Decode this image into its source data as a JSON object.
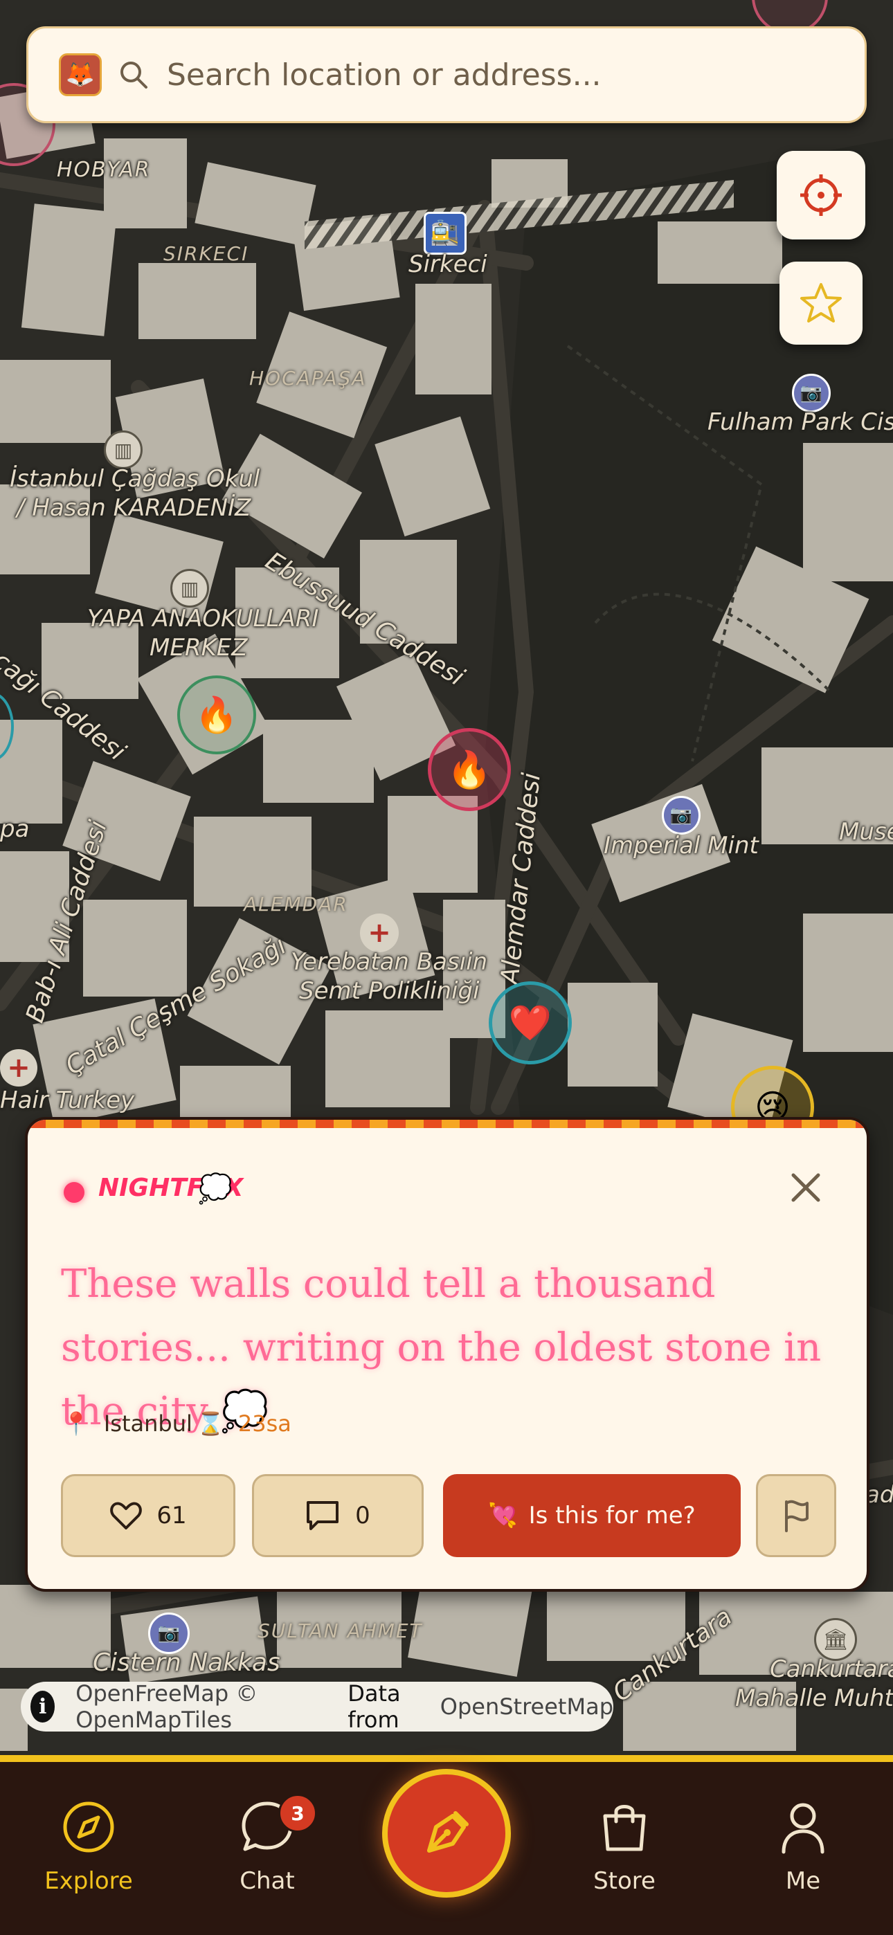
{
  "map": {
    "labels": {
      "hobyar": "HOBYAR",
      "sirkeci_district": "SIRKECI",
      "sirkeci_station": "Sirkeci",
      "hocapasa": "HOCAPAŞA",
      "fulham": "Fulham Park Ciste",
      "school1_line1": "İstanbul Çağdaş Okul",
      "school1_line2": "/ Hasan KARADENİZ",
      "ebussuud": "Ebussuud Caddesi",
      "school2_line1": "YAPA ANAOKULLARI",
      "school2_line2": "MERKEZ",
      "cagi": "ocağı Caddesi",
      "pa": "pa",
      "imperial_mint": "Imperial Mint",
      "muse": "Muse",
      "babiali": "Bab-ı Ali Caddesi",
      "alemdar_district": "ALEMDAR",
      "alemdar_street": "Alemdar Caddesi",
      "clinic_line1": "Yerebatan Basıin",
      "clinic_line2": "Semt Polikliniği",
      "catal": "Çatal Çeşme Sokağı",
      "hair": "Hair Turkey",
      "sultanahmet": "SULTAN AHMET",
      "cistern": "Cistern Nakkas",
      "cankurtaran_street": "Cankurtara",
      "cankurtaran1": "Cankurtaran",
      "cankurtaran2": "Mahalle Muhta",
      "ad": "ad"
    },
    "pins": {
      "fire1": "🔥",
      "fire2": "🔥",
      "heart": "❤️",
      "cry": "😢"
    }
  },
  "search": {
    "placeholder": "Search location or address...",
    "avatar": "🦊"
  },
  "controls": {
    "locate_icon": "crosshair-icon",
    "favorites_icon": "star-icon"
  },
  "post_card": {
    "author": "NIGHTFOX",
    "author_emoji": "💭",
    "message": "These walls could tell a thousand stories... writing on the oldest stone in the city 💭",
    "location_pin": "📍",
    "location": "Istanbul",
    "timer_icon": "⌛",
    "time_left": "23sa",
    "likes": "61",
    "comments": "0",
    "match_emoji": "💘",
    "match_label": "Is this for me?"
  },
  "attribution": {
    "info": "i",
    "text_a": "OpenFreeMap © OpenMapTiles",
    "text_b": "Data from",
    "text_c": "OpenStreetMap"
  },
  "nav": {
    "explore": "Explore",
    "chat": "Chat",
    "chat_badge": "3",
    "store": "Store",
    "me": "Me"
  },
  "colors": {
    "accent": "#d43a22",
    "highlight": "#f2c21d",
    "nav_bg": "#2a160f",
    "card_bg": "#fff7ea",
    "author": "#ff2f64"
  }
}
